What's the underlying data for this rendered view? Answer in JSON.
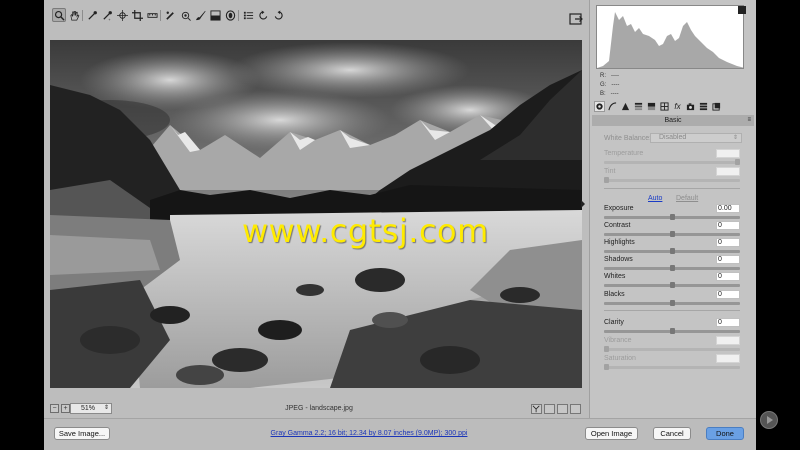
{
  "toolbar": {
    "tools": [
      "zoom-tool",
      "hand-tool",
      "white-balance-tool",
      "color-sampler-tool",
      "targeted-adjustment-tool",
      "crop-tool",
      "straighten-tool",
      "spot-removal-tool",
      "red-eye-tool",
      "adjustment-brush-tool",
      "graduated-filter-tool",
      "radial-filter-tool",
      "preferences",
      "rotate-left",
      "rotate-right"
    ]
  },
  "image": {
    "watermark": "www.cgtsj.com",
    "zoom": "51%",
    "filename": "JPEG  -  landscape.jpg"
  },
  "histogram": {
    "r_label": "R:",
    "g_label": "G:",
    "b_label": "B:",
    "r_value": "----",
    "g_value": "----",
    "b_value": "----"
  },
  "panel": {
    "section_title": "Basic",
    "white_balance_label": "White Balance:",
    "white_balance_value": "Disabled",
    "auto_label": "Auto",
    "default_label": "Default",
    "sliders": [
      {
        "label": "Temperature",
        "value": "",
        "level": 1.0,
        "dim": true
      },
      {
        "label": "Tint",
        "value": "",
        "level": 0.0,
        "dim": true
      },
      {
        "label": "Exposure",
        "value": "0.00",
        "level": 0.5,
        "dim": false
      },
      {
        "label": "Contrast",
        "value": "0",
        "level": 0.5,
        "dim": false
      },
      {
        "label": "Highlights",
        "value": "0",
        "level": 0.5,
        "dim": false
      },
      {
        "label": "Shadows",
        "value": "0",
        "level": 0.5,
        "dim": false
      },
      {
        "label": "Whites",
        "value": "0",
        "level": 0.5,
        "dim": false
      },
      {
        "label": "Blacks",
        "value": "0",
        "level": 0.5,
        "dim": false
      },
      {
        "label": "Clarity",
        "value": "0",
        "level": 0.5,
        "dim": false
      },
      {
        "label": "Vibrance",
        "value": "",
        "level": 0.0,
        "dim": true
      },
      {
        "label": "Saturation",
        "value": "",
        "level": 0.0,
        "dim": true
      }
    ]
  },
  "bottom": {
    "save_label": "Save Image...",
    "info_link": "Gray Gamma 2.2; 16 bit; 12.34 by 8.07 inches (9.0MP); 300 ppi",
    "open_label": "Open Image",
    "cancel_label": "Cancel",
    "done_label": "Done"
  },
  "colors": {
    "accent": "#6aa0e4",
    "link": "#1b35b8",
    "watermark": "#ffeb00"
  }
}
